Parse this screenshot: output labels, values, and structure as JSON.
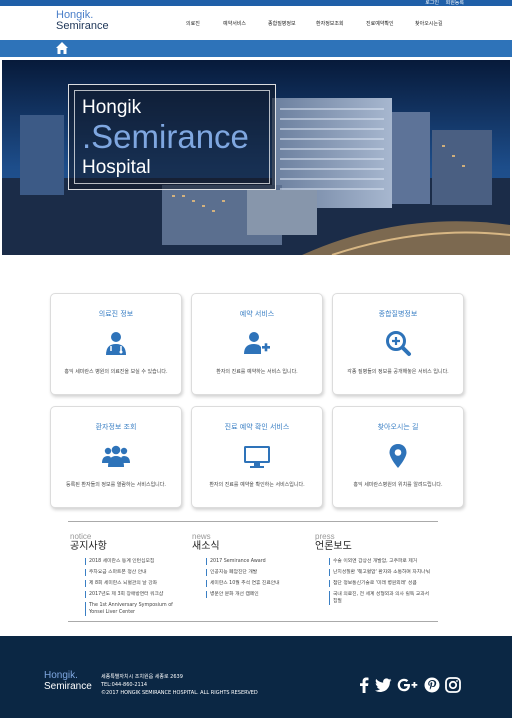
{
  "topbar": {
    "login": "로그인",
    "register": "회원등록"
  },
  "logo": {
    "line1": "Hongik.",
    "line2": "Semirance"
  },
  "nav": [
    "의료진",
    "예약서비스",
    "종합질병정보",
    "환자정보조회",
    "진료예약확인",
    "찾아오시는길"
  ],
  "hero": {
    "line1": "Hongik",
    "line2": ".Semirance",
    "line3": "Hospital"
  },
  "cards": [
    {
      "title": "의료진 정보",
      "icon": "doctor-icon",
      "desc": "홍익 세미란스 병원의 의료진을 보실 수 있습니다."
    },
    {
      "title": "예약 서비스",
      "icon": "add-user-icon",
      "desc": "환자의 진료를 예약하는 서비스 입니다."
    },
    {
      "title": "종합질병정보",
      "icon": "search-plus-icon",
      "desc": "각종 질병들의 정보를 공개해놓은 서비스 입니다."
    },
    {
      "title": "환자정보 조회",
      "icon": "users-icon",
      "desc": "등록된 환자들의 정보를 열람하는 서비스입니다."
    },
    {
      "title": "진료 예약 확인 서비스",
      "icon": "monitor-icon",
      "desc": "환자의 진료를 예약을 확인하는 서비스입니다."
    },
    {
      "title": "찾아오시는 길",
      "icon": "map-marker-icon",
      "desc": "홍익 세미란스병원의 위치를 알려드립니다."
    }
  ],
  "news": [
    {
      "en": "notice",
      "ko": "공지사항",
      "items": [
        "2018 세미란스 동계 인턴십모집",
        "주차요금 스마트폰 정산 안내",
        "제 8회 세미란스 뇌혈관의 날 강좌",
        "2017년도 제 3회 장애방면터 워크샵",
        "The 1st Anniversary Symposium of Yonsei Liver Center"
      ]
    },
    {
      "en": "news",
      "ko": "새소식",
      "items": [
        "2017 Semirance Award",
        "인공지능 폐암진단 개발",
        "세미란스 10월 추석 연휴 진료안내",
        "병문안 문화 개선 캠페인"
      ]
    },
    {
      "en": "press",
      "ko": "언론보도",
      "items": [
        "수술 이외엔 갑상선 개발암, 고주파로 제거",
        "난치성질환 '췌고혈압' 환자와 소통하며 자치나눠",
        "첨단 정보통신기술로 '미래 병원외래' 성큼",
        "국내 의료진, 전 세계 성형외과 의사 릴독 교과서 집필"
      ]
    }
  ],
  "footer": {
    "logo_line1": "Hongik.",
    "logo_line2": "Semirance",
    "address": "세종특별자치시 조치원읍 세종로 2639",
    "tel": "TEL:044-860-2114",
    "copyright": "©2017 HONGIK SEMIRANCE HOSPITAL. ALL RIGHTS RESERVED",
    "social": [
      "facebook-icon",
      "twitter-icon",
      "google-plus-icon",
      "pinterest-icon",
      "instagram-icon"
    ]
  },
  "colors": {
    "primary": "#1f5fa8",
    "accent": "#3a7fc4",
    "footer": "#0b2744"
  }
}
